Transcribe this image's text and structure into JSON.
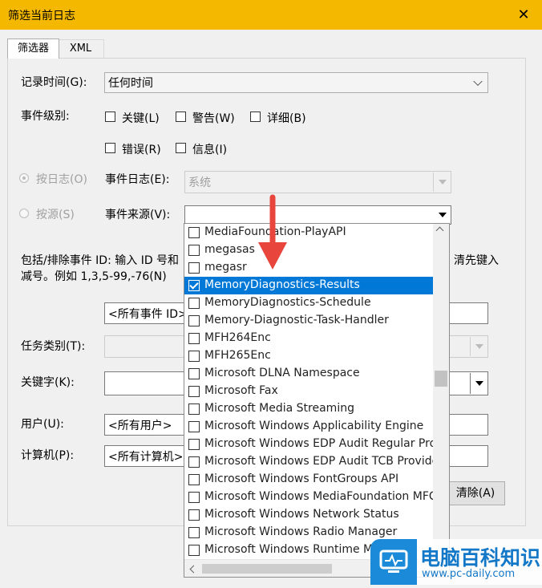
{
  "window": {
    "title": "筛选当前日志",
    "close_glyph": "✕"
  },
  "tabs": [
    {
      "label": "筛选器"
    },
    {
      "label": "XML"
    }
  ],
  "logged": {
    "label": "记录时间(G):",
    "value": "任何时间"
  },
  "event_level": {
    "label": "事件级别:",
    "checkboxes": [
      {
        "label": "关键(L)",
        "checked": false
      },
      {
        "label": "警告(W)",
        "checked": false
      },
      {
        "label": "详细(B)",
        "checked": false
      },
      {
        "label": "错误(R)",
        "checked": false
      },
      {
        "label": "信息(I)",
        "checked": false
      }
    ]
  },
  "by_log": {
    "radio_label": "按日志(O)",
    "field_label": "事件日志(E):",
    "value": "系统"
  },
  "by_source": {
    "radio_label": "按源(S)",
    "field_label": "事件来源(V):",
    "value": ""
  },
  "event_ids": {
    "desc_left": "包括/排除事件 ID: 输入 ID 号和",
    "desc_right": "清先键入",
    "desc_line2": "减号。例如 1,3,5-99,-76(N)",
    "placeholder": "<所有事件 ID>"
  },
  "task_category": {
    "label": "任务类别(T):"
  },
  "keywords": {
    "label": "关键字(K):"
  },
  "user": {
    "label": "用户(U):",
    "value": "<所有用户>"
  },
  "computer": {
    "label": "计算机(P):",
    "value": "<所有计算机>"
  },
  "clear_button": {
    "label": "清除(A)"
  },
  "source_list": {
    "items": [
      {
        "label": "MediaFoundation-PlayAPI",
        "checked": false
      },
      {
        "label": "megasas",
        "checked": false
      },
      {
        "label": "megasr",
        "checked": false
      },
      {
        "label": "MemoryDiagnostics-Results",
        "checked": true
      },
      {
        "label": "MemoryDiagnostics-Schedule",
        "checked": false
      },
      {
        "label": "Memory-Diagnostic-Task-Handler",
        "checked": false
      },
      {
        "label": "MFH264Enc",
        "checked": false
      },
      {
        "label": "MFH265Enc",
        "checked": false
      },
      {
        "label": "Microsoft DLNA Namespace",
        "checked": false
      },
      {
        "label": "Microsoft Fax",
        "checked": false
      },
      {
        "label": "Microsoft Media Streaming",
        "checked": false
      },
      {
        "label": "Microsoft Windows Applicability Engine",
        "checked": false
      },
      {
        "label": "Microsoft Windows EDP Audit Regular Prov",
        "checked": false
      },
      {
        "label": "Microsoft Windows EDP Audit TCB Provider",
        "checked": false
      },
      {
        "label": "Microsoft Windows FontGroups API",
        "checked": false
      },
      {
        "label": "Microsoft Windows MediaFoundation MFCa",
        "checked": false
      },
      {
        "label": "Microsoft Windows Network Status",
        "checked": false
      },
      {
        "label": "Microsoft Windows Radio Manager",
        "checked": false
      },
      {
        "label": "Microsoft Windows Runtime Me",
        "checked": false
      }
    ],
    "selected_index": 3
  },
  "colors": {
    "titlebar": "#f5b800",
    "selection": "#0078d7",
    "arrow": "#e8453c"
  },
  "watermark": {
    "text": "电脑百科知识",
    "url": "www.pc-daily.com"
  }
}
